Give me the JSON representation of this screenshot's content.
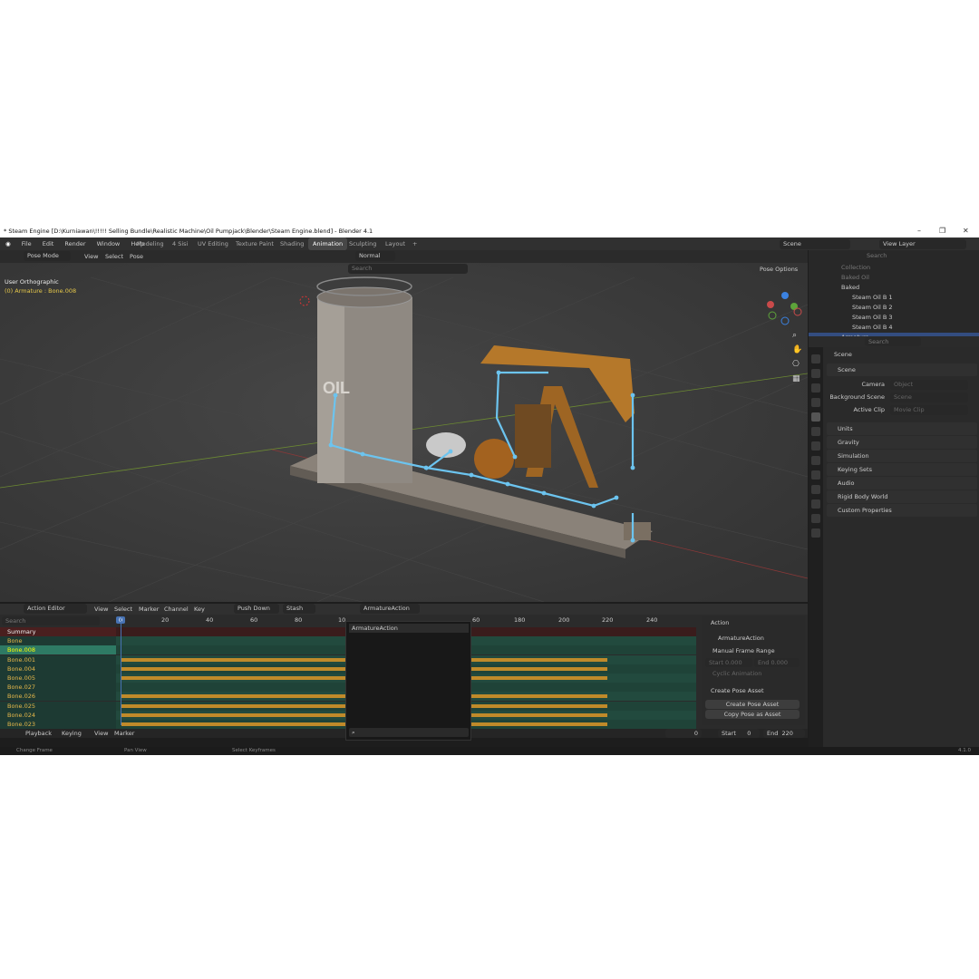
{
  "title": "* Steam Engine [D:\\Kurniawan\\!!!!! Selling Bundle\\Realistic Machine\\Oil Pumpjack\\Blender\\Steam Engine.blend] - Blender 4.1",
  "menu": [
    "File",
    "Edit",
    "Render",
    "Window",
    "Help"
  ],
  "workspaces": [
    "Modeling",
    "4 Sisi",
    "UV Editing",
    "Texture Paint",
    "Shading",
    "Animation",
    "Sculpting",
    "Layout"
  ],
  "active_workspace": "Animation",
  "scene_field": "Scene",
  "view_layer_field": "View Layer",
  "viewport": {
    "mode": "Pose Mode",
    "menus": [
      "View",
      "Select",
      "Pose"
    ],
    "orientation": "Normal",
    "search_placeholder": "Search",
    "pose_options": "Pose Options",
    "view_name": "User Orthographic",
    "active_info": "(0) Armature : Bone.008",
    "tank_label": "OIL"
  },
  "outliner": {
    "search_placeholder": "Search",
    "rows": [
      "Collection",
      "Baked Oil",
      "Baked",
      "Steam Oil B 1",
      "Steam Oil B 2",
      "Steam Oil B 3",
      "Steam Oil B 4",
      "Armature"
    ]
  },
  "properties": {
    "search_placeholder": "Search",
    "header": "Scene",
    "panel": "Scene",
    "camera_label": "Camera",
    "camera_placeholder": "Object",
    "bg_scene_label": "Background Scene",
    "bg_scene_placeholder": "Scene",
    "active_clip_label": "Active Clip",
    "active_clip_placeholder": "Movie Clip",
    "sections": [
      "Units",
      "Gravity",
      "Simulation",
      "Keying Sets",
      "Audio",
      "Rigid Body World",
      "Custom Properties"
    ]
  },
  "dopesheet": {
    "editor": "Action Editor",
    "menus": [
      "View",
      "Select",
      "Marker",
      "Channel",
      "Key"
    ],
    "push_down": "Push Down",
    "stash": "Stash",
    "action_name": "ArmatureAction",
    "search_placeholder": "Search",
    "current_frame": "0",
    "ruler": [
      "20",
      "40",
      "60",
      "80",
      "10",
      "60",
      "180",
      "200",
      "220",
      "240"
    ],
    "channels": [
      "Summary",
      "Bone",
      "Bone.008",
      "Bone.001",
      "Bone.004",
      "Bone.005",
      "Bone.027",
      "Bone.026",
      "Bone.025",
      "Bone.024",
      "Bone.023"
    ],
    "popup_item": "ArmatureAction",
    "side": {
      "action_header": "Action",
      "action_name": "ArmatureAction",
      "manual_range": "Manual Frame Range",
      "start_label": "Start",
      "start_val": "0.000",
      "end_label": "End",
      "end_val": "0.000",
      "cyclic": "Cyclic Animation",
      "create_pose_header": "Create Pose Asset",
      "create_pose_btn": "Create Pose Asset",
      "copy_pose_btn": "Copy Pose as Asset"
    }
  },
  "timeline": {
    "menus": [
      "Playback",
      "Keying",
      "View",
      "Marker"
    ],
    "frame": "0",
    "start_label": "Start",
    "start": "0",
    "end_label": "End",
    "end": "220"
  },
  "statusbar": {
    "change_frame": "Change Frame",
    "pan_view": "Pan View",
    "select_keyframes": "Select Keyframes",
    "version": "4.1.0"
  },
  "colors": {
    "accent": "#4772b3",
    "keyframe": "#e0a030",
    "channel_bg": "#1f5a47",
    "bone_line": "#6cc4ef"
  }
}
